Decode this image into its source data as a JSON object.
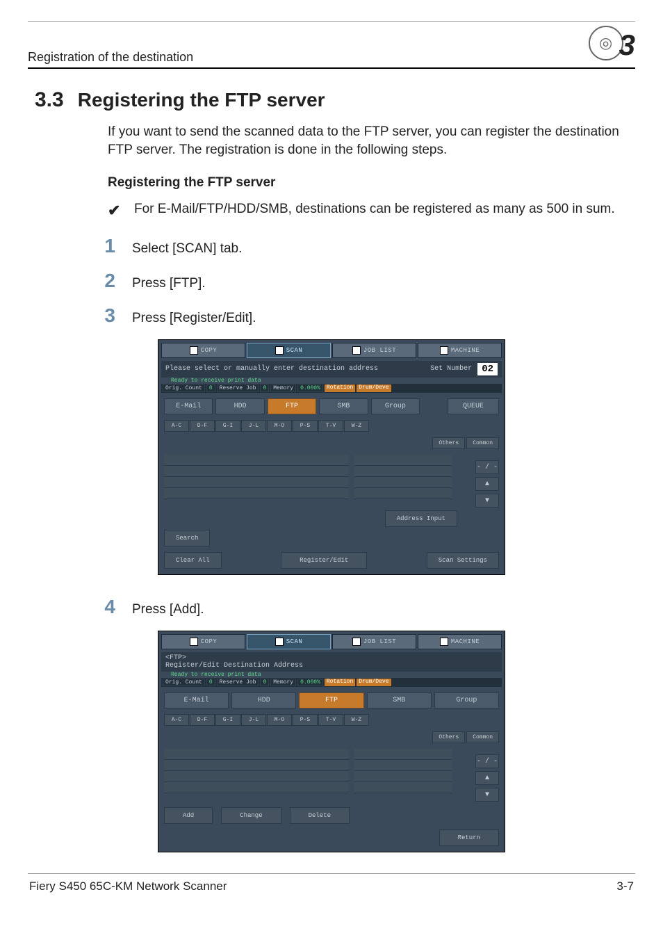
{
  "header": {
    "breadcrumb": "Registration of the destination",
    "chapter": "3"
  },
  "section": {
    "number": "3.3",
    "title": "Registering the FTP server",
    "intro": "If you want to send the scanned data to the FTP server, you can register the destination FTP server. The registration is done in the following steps."
  },
  "sub1": {
    "heading": "Registering the FTP server",
    "note": "For E-Mail/FTP/HDD/SMB, destinations can be registered as many as 500 in sum."
  },
  "steps": {
    "s1": {
      "n": "1",
      "t": "Select [SCAN] tab."
    },
    "s2": {
      "n": "2",
      "t": "Press [FTP]."
    },
    "s3": {
      "n": "3",
      "t": "Press [Register/Edit]."
    },
    "s4": {
      "n": "4",
      "t": "Press [Add]."
    }
  },
  "tabs": {
    "copy": "COPY",
    "scan": "SCAN",
    "joblist": "JOB LIST",
    "machine": "MACHINE"
  },
  "status": {
    "orig": "Orig. Count",
    "orig_v": "0",
    "reserve": "Reserve Job",
    "reserve_v": "0",
    "memory": "Memory",
    "memory_v": "0.000%",
    "rotation": "Rotation",
    "drum": "Drum/Deve"
  },
  "ui1": {
    "msg": "Please select or manually enter destination address",
    "ready": "Ready to receive print data",
    "setnum_label": "Set Number",
    "setnum_val": "02",
    "modes": {
      "email": "E-Mail",
      "hdd": "HDD",
      "ftp": "FTP",
      "smb": "SMB",
      "group": "Group",
      "queue": "QUEUE"
    },
    "side": {
      "others": "Others",
      "common": "Common",
      "page": "- / -"
    },
    "addr_input": "Address Input",
    "search": "Search",
    "clear": "Clear All",
    "regedit": "Register/Edit",
    "scanset": "Scan Settings"
  },
  "ui2": {
    "title": "<FTP>",
    "sub": "Register/Edit Destination Address",
    "ready": "Ready to receive print data",
    "modes": {
      "email": "E-Mail",
      "hdd": "HDD",
      "ftp": "FTP",
      "smb": "SMB",
      "group": "Group"
    },
    "side": {
      "others": "Others",
      "common": "Common",
      "page": "- / -"
    },
    "add": "Add",
    "change": "Change",
    "delete": "Delete",
    "return": "Return"
  },
  "letters": {
    "l0": "A-C",
    "l1": "D-F",
    "l2": "G-I",
    "l3": "J-L",
    "l4": "M-O",
    "l5": "P-S",
    "l6": "T-V",
    "l7": "W-Z"
  },
  "footer": {
    "left": "Fiery S450 65C-KM Network Scanner",
    "right": "3-7"
  },
  "arrows": {
    "up": "▲",
    "down": "▼"
  }
}
